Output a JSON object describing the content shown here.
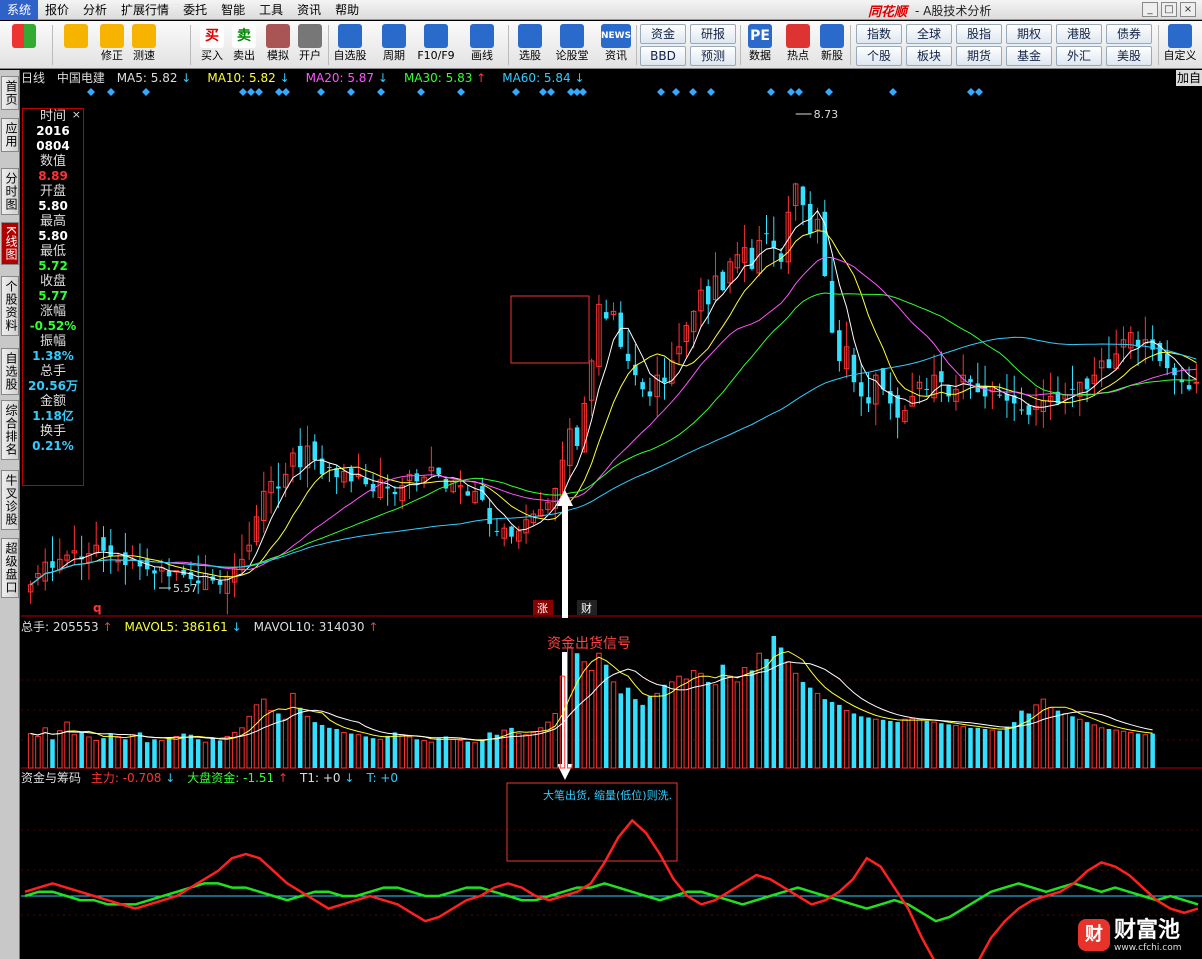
{
  "menu": {
    "items": [
      "系统",
      "报价",
      "分析",
      "扩展行情",
      "委托",
      "智能",
      "工具",
      "资讯",
      "帮助"
    ],
    "active_index": 0,
    "brand": "同花顺",
    "brand_sub": "- A股技术分析"
  },
  "toolbar": {
    "buttons": [
      {
        "label": "",
        "icon": "grid-icon"
      },
      {
        "label": "",
        "icon": "back-arrow-icon"
      },
      {
        "label": "修正",
        "icon": "fix-icon"
      },
      {
        "label": "测速",
        "icon": "clock-icon"
      },
      {
        "label": "买入",
        "icon": "buy-icon",
        "glyph": "买"
      },
      {
        "label": "卖出",
        "icon": "sell-icon",
        "glyph": "卖"
      },
      {
        "label": "模拟",
        "icon": "hammer-icon"
      },
      {
        "label": "开户",
        "icon": "lock-icon"
      },
      {
        "label": "自选股",
        "icon": "star-icon"
      },
      {
        "label": "周期",
        "icon": "cycle-icon"
      },
      {
        "label": "F10/F9",
        "icon": "f10-icon"
      },
      {
        "label": "画线",
        "icon": "pen-icon"
      },
      {
        "label": "选股",
        "icon": "select-icon"
      },
      {
        "label": "论股堂",
        "icon": "forum-icon"
      },
      {
        "label": "资讯",
        "icon": "news-icon",
        "glyph": "NEWS"
      },
      {
        "label": "数据",
        "icon": "pe-icon",
        "glyph": "PE"
      },
      {
        "label": "热点",
        "icon": "hot-icon"
      },
      {
        "label": "新股",
        "icon": "new-stock-icon"
      }
    ],
    "mid_grid": [
      "资金",
      "研报",
      "BBD",
      "预测"
    ],
    "right_grid": [
      "指数",
      "全球",
      "股指",
      "期权",
      "港股",
      "债券",
      "个股",
      "板块",
      "期货",
      "基金",
      "外汇",
      "美股"
    ],
    "custom_label": "自定义"
  },
  "side_tabs": [
    "首页",
    "应用",
    "分时图",
    "K线图",
    "个股资料",
    "自选股",
    "综合排名",
    "牛叉诊股",
    "超级盘口"
  ],
  "side_tab_active": 3,
  "header": {
    "period": "日线",
    "stock": "中国电建",
    "ma": [
      {
        "label": "MA5: 5.82",
        "dir": "↓",
        "color": "white"
      },
      {
        "label": "MA10: 5.82",
        "dir": "↓",
        "color": "yellow"
      },
      {
        "label": "MA20: 5.87",
        "dir": "↓",
        "color": "magenta"
      },
      {
        "label": "MA30: 5.83",
        "dir": "↑",
        "color": "green"
      },
      {
        "label": "MA60: 5.84",
        "dir": "↓",
        "color": "cyan"
      }
    ],
    "add_tab": "加自"
  },
  "info_panel": [
    {
      "label": "时间",
      "value": "2016\n0804",
      "color": "white"
    },
    {
      "label": "数值",
      "value": "8.89",
      "color": "red"
    },
    {
      "label": "开盘",
      "value": "5.80",
      "color": "white"
    },
    {
      "label": "最高",
      "value": "5.80",
      "color": "white"
    },
    {
      "label": "最低",
      "value": "5.72",
      "color": "green"
    },
    {
      "label": "收盘",
      "value": "5.77",
      "color": "green"
    },
    {
      "label": "涨幅",
      "value": "-0.52%",
      "color": "green"
    },
    {
      "label": "振幅",
      "value": "1.38%",
      "color": "cyan"
    },
    {
      "label": "总手",
      "value": "20.56万",
      "color": "cyan"
    },
    {
      "label": "金额",
      "value": "1.18亿",
      "color": "cyan"
    },
    {
      "label": "换手",
      "value": "0.21%",
      "color": "cyan"
    }
  ],
  "price_annotations": {
    "high_label": "8.73",
    "low_label": "5.57",
    "marker_q": "q",
    "marker_zhang": "涨",
    "marker_cai": "财",
    "signal_text": "资金出货信号"
  },
  "volume_header": [
    {
      "label": "总手: 205553",
      "dir": "↑",
      "color": "white",
      "dircolor": "red"
    },
    {
      "label": "MAVOL5: 386161",
      "dir": "↓",
      "color": "yellow",
      "dircolor": "cyan"
    },
    {
      "label": "MAVOL10: 314030",
      "dir": "↑",
      "color": "white",
      "dircolor": "red"
    }
  ],
  "fund_header": [
    {
      "label": "资金与筹码",
      "dir": "",
      "color": "white"
    },
    {
      "label": "主力: -0.708",
      "dir": "↓",
      "color": "red",
      "dircolor": "cyan"
    },
    {
      "label": "大盘资金: -1.51",
      "dir": "↑",
      "color": "green",
      "dircolor": "red"
    },
    {
      "label": "T1: +0",
      "dir": "↓",
      "color": "white",
      "dircolor": "cyan"
    },
    {
      "label": "T: +0",
      "dir": "",
      "color": "cyan"
    }
  ],
  "fund_annotation": "大笔出货, 缩量(低位)则洗.",
  "watermark": {
    "text": "财富池",
    "glyph": "财",
    "url": "www.cfchi.com"
  },
  "colors": {
    "up": "#ff3333",
    "down": "#33e0ff",
    "ma5": "#ffffff",
    "ma10": "#ffff33",
    "ma20": "#ff55ff",
    "ma30": "#33ff33",
    "ma60": "#33ccff",
    "fund_main": "#ff2020",
    "fund_market": "#20e020"
  },
  "chart_data": {
    "type": "candlestick",
    "price_range": [
      5.4,
      9.0
    ],
    "closes": [
      5.62,
      5.7,
      5.78,
      5.74,
      5.8,
      5.83,
      5.86,
      5.8,
      5.84,
      5.9,
      5.86,
      5.82,
      5.79,
      5.76,
      5.8,
      5.75,
      5.73,
      5.7,
      5.74,
      5.68,
      5.72,
      5.69,
      5.66,
      5.63,
      5.7,
      5.65,
      5.62,
      5.68,
      5.74,
      5.8,
      5.9,
      6.1,
      6.28,
      6.35,
      6.3,
      6.4,
      6.55,
      6.45,
      6.6,
      6.5,
      6.4,
      6.45,
      6.38,
      6.42,
      6.35,
      6.4,
      6.33,
      6.28,
      6.36,
      6.3,
      6.26,
      6.32,
      6.4,
      6.35,
      6.38,
      6.45,
      6.4,
      6.3,
      6.35,
      6.32,
      6.25,
      6.28,
      6.22,
      6.05,
      6.0,
      6.02,
      5.96,
      6.0,
      6.08,
      6.12,
      6.15,
      6.2,
      6.3,
      6.5,
      6.72,
      6.6,
      6.9,
      7.2,
      7.6,
      7.5,
      7.55,
      7.3,
      7.2,
      7.1,
      7.0,
      6.95,
      7.1,
      7.05,
      7.2,
      7.3,
      7.45,
      7.55,
      7.7,
      7.6,
      7.8,
      7.7,
      7.9,
      7.95,
      8.0,
      7.85,
      8.05,
      8.1,
      8.0,
      7.9,
      8.25,
      8.45,
      8.3,
      8.1,
      8.2,
      7.8,
      7.4,
      7.2,
      7.3,
      7.05,
      6.95,
      6.9,
      7.1,
      7.0,
      6.9,
      6.8,
      6.85,
      6.95,
      7.05,
      7.0,
      7.1,
      7.05,
      6.95,
      7.0,
      7.1,
      7.05,
      6.98,
      6.95,
      7.02,
      6.96,
      6.92,
      6.9,
      6.85,
      6.82,
      6.88,
      6.92,
      6.95,
      6.9,
      6.96,
      7.0,
      7.05,
      7.0,
      7.1,
      7.2,
      7.15,
      7.25,
      7.35,
      7.4,
      7.3,
      7.35,
      7.28,
      7.2,
      7.15,
      7.1,
      7.05,
      7.0,
      7.05
    ]
  },
  "fund_series": {
    "main": [
      0.1,
      0.2,
      0.3,
      0.2,
      0.1,
      0.0,
      -0.1,
      -0.2,
      -0.3,
      -0.2,
      -0.1,
      0.0,
      0.2,
      0.4,
      0.6,
      0.9,
      1.0,
      0.9,
      0.6,
      0.3,
      0.1,
      -0.1,
      -0.3,
      -0.2,
      -0.1,
      0.0,
      -0.1,
      -0.2,
      -0.4,
      -0.6,
      -0.5,
      -0.3,
      -0.1,
      0.0,
      0.2,
      0.3,
      0.2,
      0.0,
      -0.1,
      0.0,
      0.1,
      0.3,
      0.8,
      1.4,
      1.8,
      1.5,
      1.0,
      0.4,
      0.0,
      -0.2,
      -0.1,
      0.1,
      0.3,
      0.5,
      0.4,
      0.2,
      0.0,
      -0.2,
      -0.1,
      0.1,
      0.4,
      0.9,
      0.7,
      0.2,
      -0.3,
      -1.0,
      -1.6,
      -1.9,
      -2.0,
      -1.6,
      -1.0,
      -0.6,
      -0.3,
      -0.1,
      0.0,
      0.1,
      0.3,
      0.6,
      0.8,
      0.7,
      0.5,
      0.2,
      -0.1,
      -0.3,
      -0.4,
      -0.3
    ],
    "market": [
      0.0,
      0.1,
      0.1,
      0.0,
      -0.1,
      -0.1,
      -0.2,
      -0.2,
      -0.2,
      -0.1,
      0.0,
      0.1,
      0.2,
      0.3,
      0.3,
      0.2,
      0.2,
      0.1,
      0.0,
      -0.1,
      0.0,
      0.1,
      0.1,
      0.0,
      0.0,
      0.1,
      0.2,
      0.2,
      0.1,
      0.0,
      0.0,
      0.1,
      0.2,
      0.2,
      0.1,
      0.0,
      -0.1,
      -0.1,
      0.0,
      0.1,
      0.2,
      0.2,
      0.3,
      0.2,
      0.1,
      0.0,
      -0.1,
      0.0,
      0.1,
      0.1,
      0.0,
      -0.1,
      -0.2,
      -0.1,
      0.0,
      0.1,
      0.2,
      0.1,
      0.0,
      -0.1,
      -0.2,
      -0.3,
      -0.2,
      -0.1,
      -0.2,
      -0.4,
      -0.6,
      -0.5,
      -0.3,
      -0.1,
      0.1,
      0.2,
      0.3,
      0.2,
      0.1,
      0.2,
      0.3,
      0.2,
      0.1,
      0.2,
      0.1,
      0.0,
      -0.1,
      0.0,
      -0.1,
      -0.2
    ]
  },
  "volume_data": [
    60,
    55,
    70,
    50,
    65,
    80,
    58,
    62,
    54,
    48,
    52,
    60,
    55,
    50,
    58,
    62,
    45,
    50,
    48,
    52,
    55,
    60,
    58,
    50,
    45,
    52,
    48,
    55,
    62,
    70,
    90,
    110,
    120,
    100,
    95,
    85,
    130,
    105,
    90,
    80,
    75,
    70,
    68,
    62,
    60,
    58,
    55,
    52,
    50,
    56,
    62,
    58,
    54,
    50,
    48,
    45,
    52,
    55,
    50,
    48,
    46,
    44,
    50,
    62,
    58,
    66,
    70,
    60,
    58,
    62,
    70,
    80,
    95,
    160,
    210,
    200,
    185,
    170,
    200,
    180,
    150,
    130,
    140,
    120,
    110,
    125,
    130,
    145,
    150,
    160,
    155,
    170,
    165,
    150,
    145,
    180,
    160,
    150,
    175,
    170,
    200,
    190,
    230,
    210,
    185,
    165,
    150,
    140,
    130,
    120,
    115,
    110,
    100,
    95,
    90,
    88,
    85,
    84,
    82,
    80,
    85,
    86,
    84,
    82,
    80,
    78,
    76,
    74,
    72,
    70,
    70,
    68,
    66,
    65,
    72,
    80,
    100,
    95,
    110,
    120,
    105,
    100,
    95,
    90,
    85,
    80,
    75,
    70,
    68,
    66,
    64,
    62,
    60,
    58,
    60
  ]
}
